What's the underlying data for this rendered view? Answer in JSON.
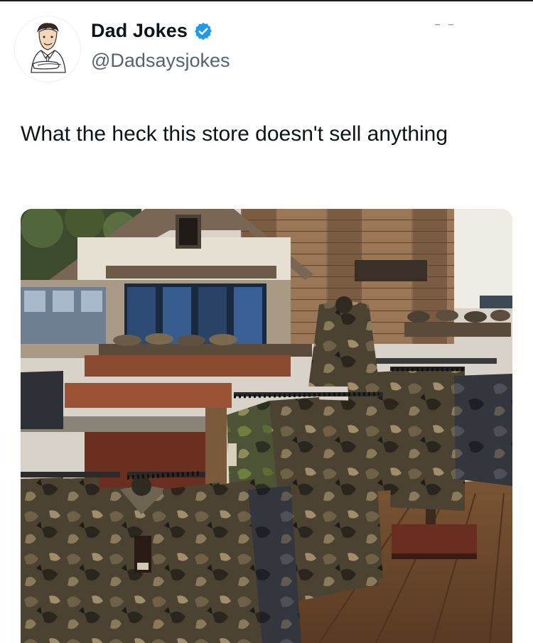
{
  "tweet": {
    "author": {
      "display_name": "Dad Jokes",
      "handle": "@Dadsaysjokes",
      "verified": true,
      "avatar_icon": "cartoon-dad-avatar",
      "verified_icon": "verified-badge-icon",
      "verified_color": "#1d9bf0"
    },
    "text": "What the heck this store doesn't sell anything",
    "more_icon": "more-options-icon",
    "media": {
      "type": "photo",
      "icon": "store-photo"
    }
  },
  "colors": {
    "text_primary": "#0f1419",
    "text_secondary": "#536471",
    "camo_dark": "#3a3427",
    "camo_mid": "#6b5d45",
    "floor": "#6e4a2c",
    "wood_wall": "#8a6a4e"
  }
}
